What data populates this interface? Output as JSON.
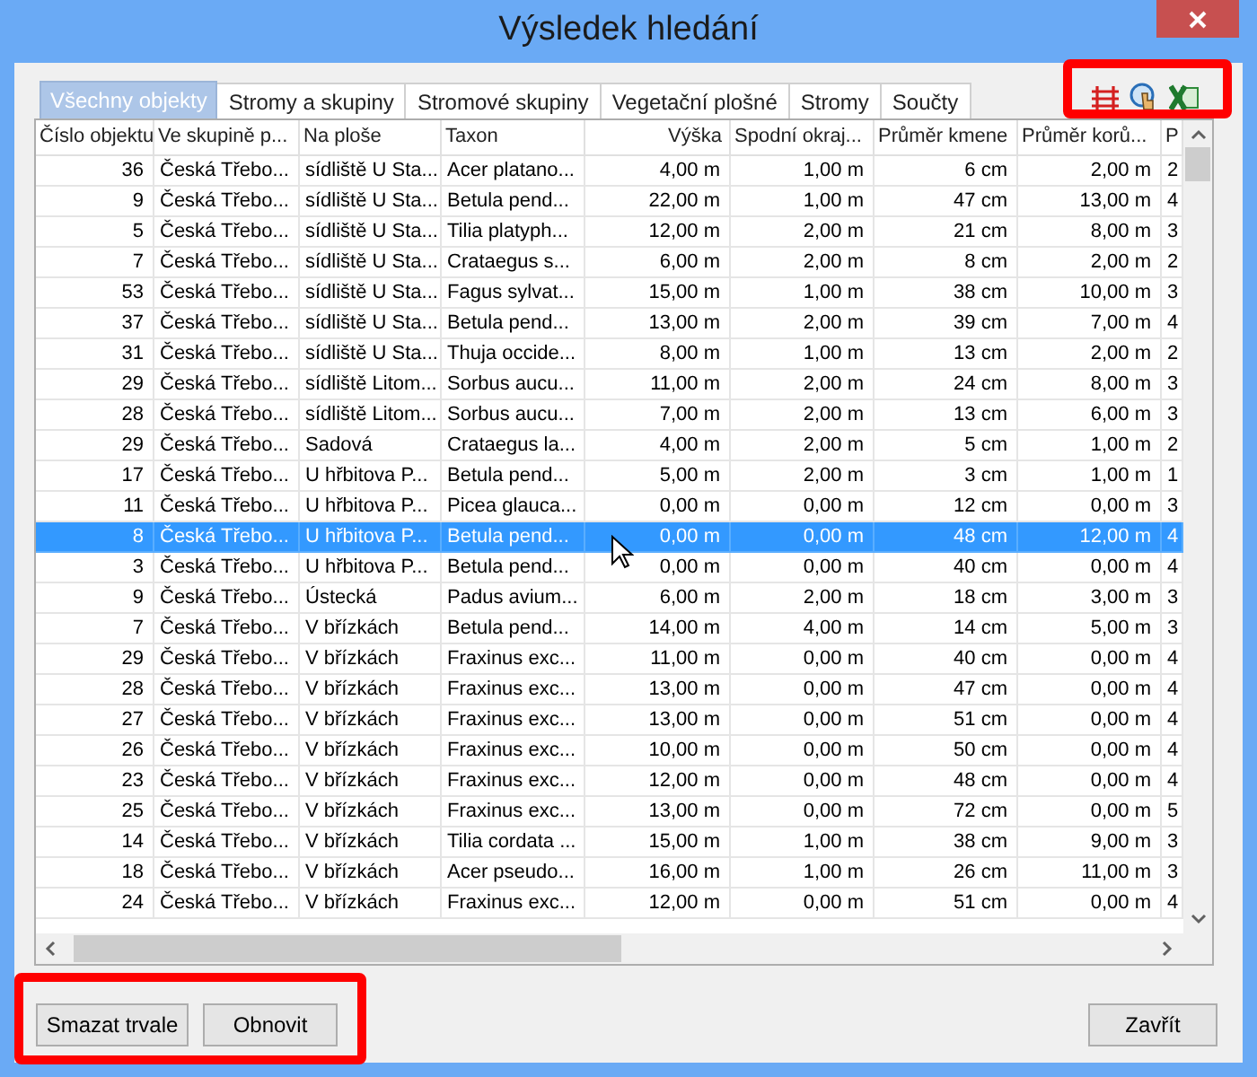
{
  "window": {
    "title": "Výsledek hledání"
  },
  "tabs": [
    {
      "label": "Všechny objekty",
      "selected": true
    },
    {
      "label": "Stromy a skupiny",
      "selected": false
    },
    {
      "label": "Stromové skupiny",
      "selected": false
    },
    {
      "label": "Vegetační plošné",
      "selected": false
    },
    {
      "label": "Stromy",
      "selected": false
    },
    {
      "label": "Součty",
      "selected": false
    }
  ],
  "table": {
    "columns": [
      "Číslo objektu",
      "Ve skupině p...",
      "Na ploše",
      "Taxon",
      "Výška",
      "Spodní okraj...",
      "Průměr kmene",
      "Průměr korů...",
      "P"
    ],
    "rows": [
      {
        "selected": false,
        "cells": [
          "36",
          "Česká Třebo...",
          "sídliště U Sta...",
          "Acer platano...",
          "4,00 m",
          "1,00 m",
          "6 cm",
          "2,00 m",
          "2"
        ]
      },
      {
        "selected": false,
        "cells": [
          "9",
          "Česká Třebo...",
          "sídliště U Sta...",
          "Betula pend...",
          "22,00 m",
          "1,00 m",
          "47 cm",
          "13,00 m",
          "4"
        ]
      },
      {
        "selected": false,
        "cells": [
          "5",
          "Česká Třebo...",
          "sídliště U Sta...",
          "Tilia platyph...",
          "12,00 m",
          "2,00 m",
          "21 cm",
          "8,00 m",
          "3"
        ]
      },
      {
        "selected": false,
        "cells": [
          "7",
          "Česká Třebo...",
          "sídliště U Sta...",
          "Crataegus s...",
          "6,00 m",
          "2,00 m",
          "8 cm",
          "2,00 m",
          "2"
        ]
      },
      {
        "selected": false,
        "cells": [
          "53",
          "Česká Třebo...",
          "sídliště U Sta...",
          "Fagus sylvat...",
          "15,00 m",
          "1,00 m",
          "38 cm",
          "10,00 m",
          "3"
        ]
      },
      {
        "selected": false,
        "cells": [
          "37",
          "Česká Třebo...",
          "sídliště U Sta...",
          "Betula pend...",
          "13,00 m",
          "2,00 m",
          "39 cm",
          "7,00 m",
          "4"
        ]
      },
      {
        "selected": false,
        "cells": [
          "31",
          "Česká Třebo...",
          "sídliště U Sta...",
          "Thuja occide...",
          "8,00 m",
          "1,00 m",
          "13 cm",
          "2,00 m",
          "2"
        ]
      },
      {
        "selected": false,
        "cells": [
          "29",
          "Česká Třebo...",
          "sídliště Litom...",
          "Sorbus aucu...",
          "11,00 m",
          "2,00 m",
          "24 cm",
          "8,00 m",
          "3"
        ]
      },
      {
        "selected": false,
        "cells": [
          "28",
          "Česká Třebo...",
          "sídliště Litom...",
          "Sorbus aucu...",
          "7,00 m",
          "2,00 m",
          "13 cm",
          "6,00 m",
          "3"
        ]
      },
      {
        "selected": false,
        "cells": [
          "29",
          "Česká Třebo...",
          "Sadová",
          "Crataegus la...",
          "4,00 m",
          "2,00 m",
          "5 cm",
          "1,00 m",
          "2"
        ]
      },
      {
        "selected": false,
        "cells": [
          "17",
          "Česká Třebo...",
          "U hřbitova P...",
          "Betula pend...",
          "5,00 m",
          "2,00 m",
          "3 cm",
          "1,00 m",
          "1"
        ]
      },
      {
        "selected": false,
        "cells": [
          "11",
          "Česká Třebo...",
          "U hřbitova P...",
          "Picea glauca...",
          "0,00 m",
          "0,00 m",
          "12 cm",
          "0,00 m",
          "3"
        ]
      },
      {
        "selected": true,
        "cells": [
          "8",
          "Česká Třebo...",
          "U hřbitova P...",
          "Betula pend...",
          "0,00 m",
          "0,00 m",
          "48 cm",
          "12,00 m",
          "4"
        ]
      },
      {
        "selected": false,
        "cells": [
          "3",
          "Česká Třebo...",
          "U hřbitova P...",
          "Betula pend...",
          "0,00 m",
          "0,00 m",
          "40 cm",
          "0,00 m",
          "4"
        ]
      },
      {
        "selected": false,
        "cells": [
          "9",
          "Česká Třebo...",
          "Ústecká",
          "Padus avium...",
          "6,00 m",
          "2,00 m",
          "18 cm",
          "3,00 m",
          "3"
        ]
      },
      {
        "selected": false,
        "cells": [
          "7",
          "Česká Třebo...",
          "V břízkách",
          "Betula pend...",
          "14,00 m",
          "4,00 m",
          "14 cm",
          "5,00 m",
          "3"
        ]
      },
      {
        "selected": false,
        "cells": [
          "29",
          "Česká Třebo...",
          "V břízkách",
          "Fraxinus exc...",
          "11,00 m",
          "0,00 m",
          "40 cm",
          "0,00 m",
          "4"
        ]
      },
      {
        "selected": false,
        "cells": [
          "28",
          "Česká Třebo...",
          "V břízkách",
          "Fraxinus exc...",
          "13,00 m",
          "0,00 m",
          "47 cm",
          "0,00 m",
          "4"
        ]
      },
      {
        "selected": false,
        "cells": [
          "27",
          "Česká Třebo...",
          "V břízkách",
          "Fraxinus exc...",
          "13,00 m",
          "0,00 m",
          "51 cm",
          "0,00 m",
          "4"
        ]
      },
      {
        "selected": false,
        "cells": [
          "26",
          "Česká Třebo...",
          "V břízkách",
          "Fraxinus exc...",
          "10,00 m",
          "0,00 m",
          "50 cm",
          "0,00 m",
          "4"
        ]
      },
      {
        "selected": false,
        "cells": [
          "23",
          "Česká Třebo...",
          "V břízkách",
          "Fraxinus exc...",
          "12,00 m",
          "0,00 m",
          "48 cm",
          "0,00 m",
          "4"
        ]
      },
      {
        "selected": false,
        "cells": [
          "25",
          "Česká Třebo...",
          "V břízkách",
          "Fraxinus exc...",
          "13,00 m",
          "0,00 m",
          "72 cm",
          "0,00 m",
          "5"
        ]
      },
      {
        "selected": false,
        "cells": [
          "14",
          "Česká Třebo...",
          "V břízkách",
          "Tilia cordata ...",
          "15,00 m",
          "1,00 m",
          "38 cm",
          "9,00 m",
          "3"
        ]
      },
      {
        "selected": false,
        "cells": [
          "18",
          "Česká Třebo...",
          "V břízkách",
          "Acer pseudo...",
          "16,00 m",
          "1,00 m",
          "26 cm",
          "11,00 m",
          "3"
        ]
      },
      {
        "selected": false,
        "cells": [
          "24",
          "Česká Třebo...",
          "V břízkách",
          "Fraxinus exc...",
          "12,00 m",
          "0,00 m",
          "51 cm",
          "0,00 m",
          "4"
        ]
      }
    ]
  },
  "buttons": [
    "Smazat trvale",
    "Obnovit"
  ],
  "close_button": "Zavřít"
}
